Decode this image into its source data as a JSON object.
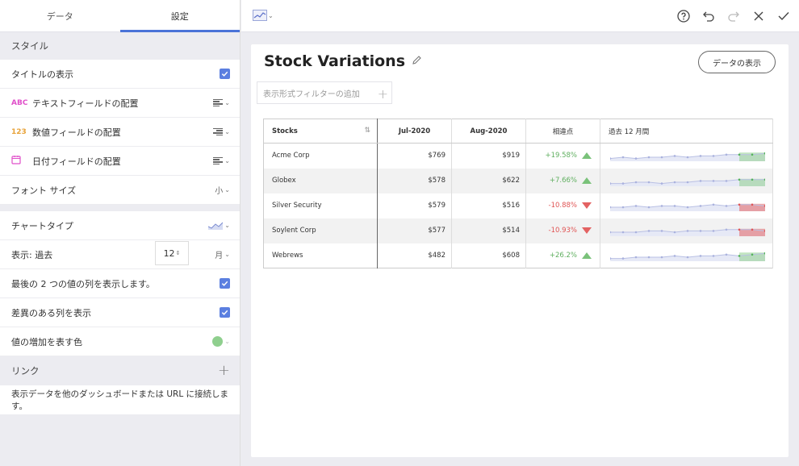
{
  "tabs": {
    "data": "データ",
    "settings": "設定"
  },
  "left": {
    "style_head": "スタイル",
    "show_title": "タイトルの表示",
    "text_align": "テキストフィールドの配置",
    "text_align_icon": "ABC",
    "num_align": "数値フィールドの配置",
    "num_align_icon": "123",
    "date_align": "日付フィールドの配置",
    "font_size": "フォント サイズ",
    "font_size_value": "小",
    "chart_type": "チャートタイプ",
    "show_past": "表示: 過去",
    "past_count": "12",
    "past_unit": "月",
    "last_two": "最後の 2 つの値の列を表示します。",
    "diff_col": "差異のある列を表示",
    "increase_color": "値の増加を表す色",
    "link_head": "リンク",
    "link_desc": "表示データを他のダッシュボードまたは URL に接続します。"
  },
  "toolbar": {
    "icons": [
      "help-icon",
      "undo-icon",
      "redo-icon",
      "close-icon",
      "check-icon"
    ]
  },
  "canvas": {
    "title": "Stock Variations",
    "view_data": "データの表示",
    "filter_placeholder": "表示形式フィルターの追加"
  },
  "table": {
    "headers": {
      "name": "Stocks",
      "col1": "Jul-2020",
      "col2": "Aug-2020",
      "delta": "相違点",
      "spark": "過去 12 月間"
    },
    "rows": [
      {
        "name": "Acme Corp",
        "jul": "$769",
        "aug": "$919",
        "delta": "+19.58%",
        "dir": "up"
      },
      {
        "name": "Globex",
        "jul": "$578",
        "aug": "$622",
        "delta": "+7.66%",
        "dir": "up"
      },
      {
        "name": "Silver Security",
        "jul": "$579",
        "aug": "$516",
        "delta": "-10.88%",
        "dir": "down"
      },
      {
        "name": "Soylent Corp",
        "jul": "$577",
        "aug": "$514",
        "delta": "-10.93%",
        "dir": "down"
      },
      {
        "name": "Webrews",
        "jul": "$482",
        "aug": "$608",
        "delta": "+26.2%",
        "dir": "up"
      }
    ]
  },
  "colors": {
    "accent": "#4a73d8",
    "increase": "#8fcf8e",
    "decrease": "#e36262",
    "spark": "#c5cae9"
  }
}
